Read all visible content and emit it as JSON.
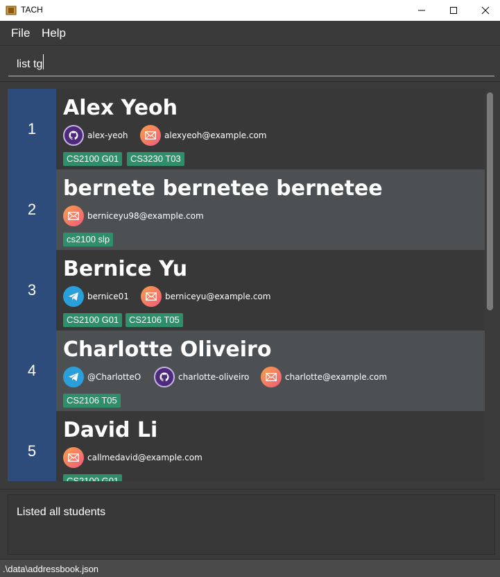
{
  "window": {
    "title": "TACH"
  },
  "menu": {
    "file": "File",
    "help": "Help"
  },
  "command": {
    "value": "list tg"
  },
  "students": [
    {
      "index": "1",
      "name": "Alex Yeoh",
      "contacts": [
        {
          "type": "github",
          "icon": "github-icon",
          "text": "alex-yeoh"
        },
        {
          "type": "email",
          "icon": "email-icon",
          "text": "alexyeoh@example.com"
        }
      ],
      "tags": [
        "CS2100 G01",
        "CS3230 T03"
      ]
    },
    {
      "index": "2",
      "name": "bernete bernetee bernetee",
      "contacts": [
        {
          "type": "email",
          "icon": "email-icon",
          "text": "berniceyu98@example.com"
        }
      ],
      "tags": [
        "cs2100 slp"
      ]
    },
    {
      "index": "3",
      "name": "Bernice Yu",
      "contacts": [
        {
          "type": "telegram",
          "icon": "telegram-icon",
          "text": "bernice01"
        },
        {
          "type": "email",
          "icon": "email-icon",
          "text": "berniceyu@example.com"
        }
      ],
      "tags": [
        "CS2100 G01",
        "CS2106 T05"
      ]
    },
    {
      "index": "4",
      "name": "Charlotte Oliveiro",
      "contacts": [
        {
          "type": "telegram",
          "icon": "telegram-icon",
          "text": "@CharlotteO"
        },
        {
          "type": "github",
          "icon": "github-icon",
          "text": "charlotte-oliveiro"
        },
        {
          "type": "email",
          "icon": "email-icon",
          "text": "charlotte@example.com"
        }
      ],
      "tags": [
        "CS2106 T05"
      ]
    },
    {
      "index": "5",
      "name": "David Li",
      "contacts": [
        {
          "type": "email",
          "icon": "email-icon",
          "text": "callmedavid@example.com"
        }
      ],
      "tags": [
        "CS2100 G01"
      ]
    }
  ],
  "result": {
    "message": "Listed all students"
  },
  "status": {
    "path": ".\\data\\addressbook.json"
  },
  "colors": {
    "index_bg": "#2d4b7b",
    "tag_bg": "#2f8f6a",
    "card_dark": "#383838",
    "card_light": "#4d5052",
    "background": "#3b3b3b"
  }
}
